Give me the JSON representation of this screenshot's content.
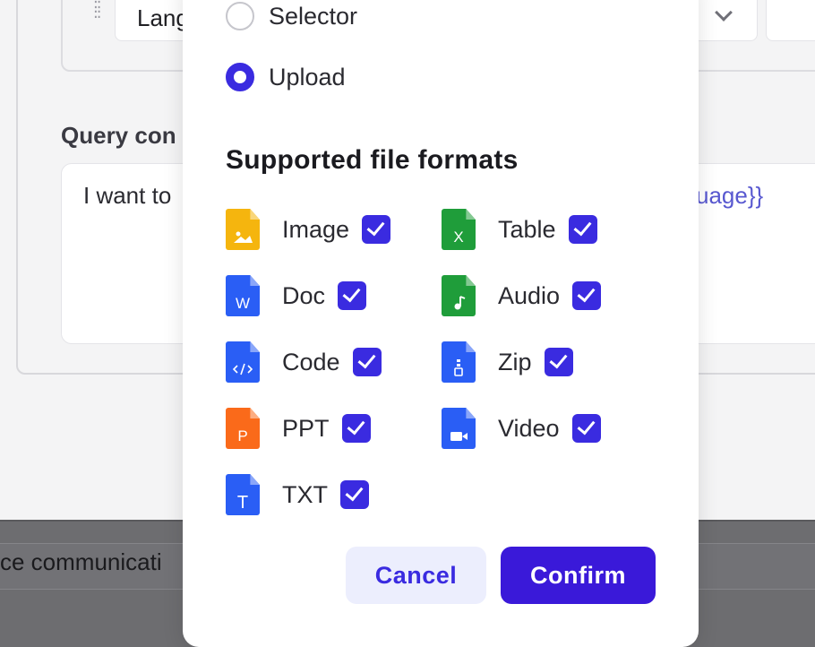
{
  "background": {
    "language_select_text": "Lang",
    "query_label": "Query con",
    "query_text": "I want to",
    "query_variable": "uage}}",
    "bottom_text": "ce communicati"
  },
  "modal": {
    "radios": [
      {
        "label": "Selector",
        "selected": false
      },
      {
        "label": "Upload",
        "selected": true
      }
    ],
    "section_title": "Supported file formats",
    "formats": [
      {
        "label": "Image",
        "icon": "image-file-icon",
        "color": "#f5b50e",
        "checked": true
      },
      {
        "label": "Table",
        "icon": "table-file-icon",
        "color": "#1f9d3a",
        "checked": true
      },
      {
        "label": "Doc",
        "icon": "doc-file-icon",
        "color": "#2a5ef5",
        "checked": true
      },
      {
        "label": "Audio",
        "icon": "audio-file-icon",
        "color": "#1f9d3a",
        "checked": true
      },
      {
        "label": "Code",
        "icon": "code-file-icon",
        "color": "#2a5ef5",
        "checked": true
      },
      {
        "label": "Zip",
        "icon": "zip-file-icon",
        "color": "#2a5ef5",
        "checked": true
      },
      {
        "label": "PPT",
        "icon": "ppt-file-icon",
        "color": "#fa6a1a",
        "checked": true
      },
      {
        "label": "Video",
        "icon": "video-file-icon",
        "color": "#2a5ef5",
        "checked": true
      },
      {
        "label": "TXT",
        "icon": "txt-file-icon",
        "color": "#2a5ef5",
        "checked": true
      }
    ],
    "icon_glyphs": {
      "table": "X",
      "doc": "W",
      "ppt": "P",
      "txt": "T"
    },
    "cancel_label": "Cancel",
    "confirm_label": "Confirm"
  },
  "colors": {
    "accent": "#3a2be0",
    "confirm_bg": "#3a19d9",
    "cancel_bg": "#eceefd"
  }
}
